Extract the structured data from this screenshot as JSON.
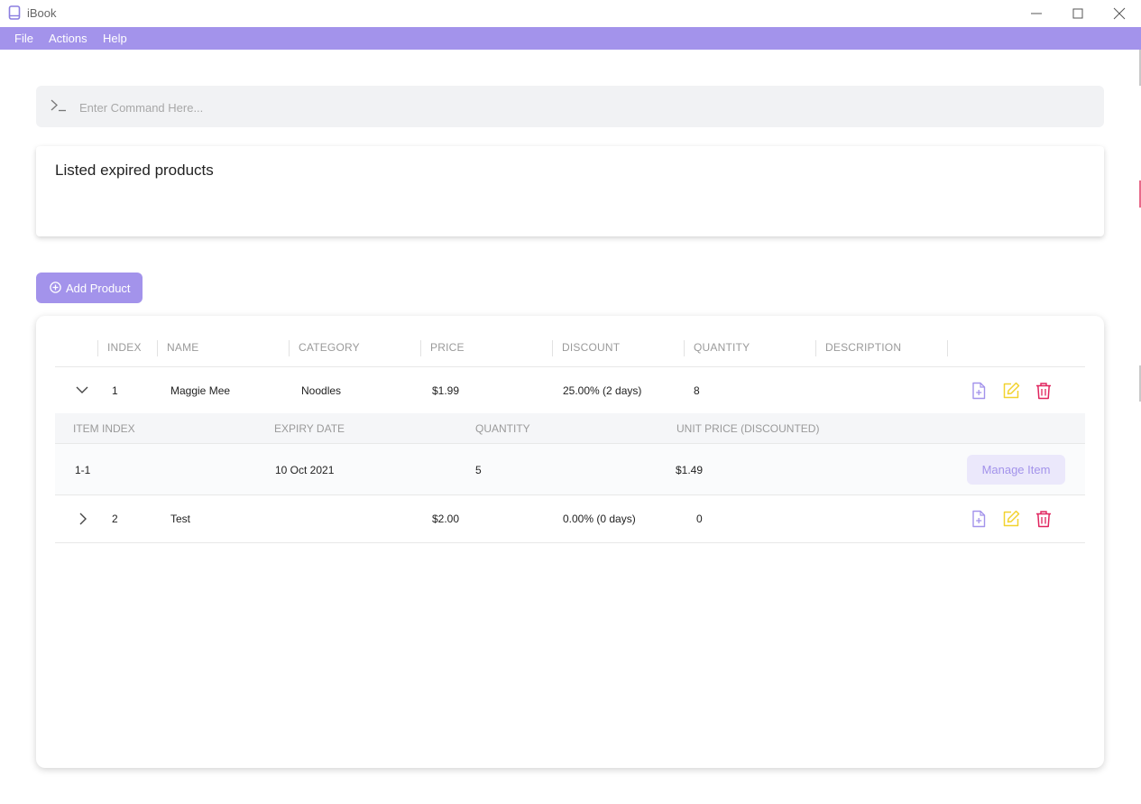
{
  "window": {
    "title": "iBook"
  },
  "menu": {
    "file": "File",
    "actions": "Actions",
    "help": "Help"
  },
  "command": {
    "placeholder": "Enter Command Here..."
  },
  "result": {
    "message": "Listed expired products"
  },
  "add_product": {
    "label": "Add Product"
  },
  "table": {
    "headers": [
      "INDEX",
      "NAME",
      "CATEGORY",
      "PRICE",
      "DISCOUNT",
      "QUANTITY",
      "DESCRIPTION"
    ],
    "rows": [
      {
        "index": "1",
        "name": "Maggie Mee",
        "category": "Noodles",
        "price": "$1.99",
        "discount": "25.00% (2 days)",
        "quantity": "8",
        "description": "",
        "expanded": true
      },
      {
        "index": "2",
        "name": "Test",
        "category": "",
        "price": "$2.00",
        "discount": "0.00% (0 days)",
        "quantity": "0",
        "description": "",
        "expanded": false
      }
    ],
    "item_headers": [
      "ITEM INDEX",
      "EXPIRY DATE",
      "QUANTITY",
      "UNIT PRICE (DISCOUNTED)"
    ],
    "items": [
      {
        "item_index": "1-1",
        "expiry": "10 Oct 2021",
        "quantity": "5",
        "unit_price": "$1.49",
        "action": "Manage Item"
      }
    ]
  },
  "colors": {
    "accent": "#a393eb",
    "view_icon": "#a393eb",
    "edit_icon": "#f2d22e",
    "delete_icon": "#e0245e"
  },
  "icons": {
    "app": "book-icon",
    "prompt": "terminal-prompt-icon",
    "add": "plus-circle-icon",
    "view": "file-view-icon",
    "edit": "edit-icon",
    "delete": "trash-icon"
  }
}
